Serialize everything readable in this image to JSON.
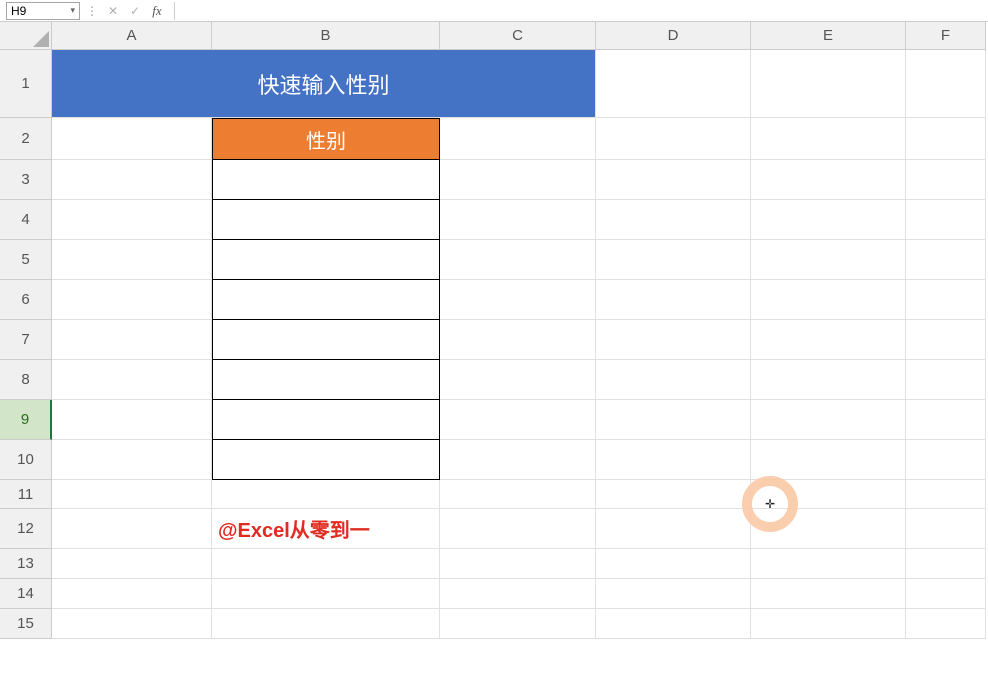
{
  "nameBox": {
    "value": "H9"
  },
  "formulaBar": {
    "cancel": "✕",
    "confirm": "✓",
    "fx": "fx",
    "value": ""
  },
  "columns": [
    "A",
    "B",
    "C",
    "D",
    "E",
    "F"
  ],
  "rows": [
    "1",
    "2",
    "3",
    "4",
    "5",
    "6",
    "7",
    "8",
    "9",
    "10",
    "11",
    "12",
    "13",
    "14",
    "15"
  ],
  "selectedRow": "9",
  "cells": {
    "title": "快速输入性别",
    "b2": "性别",
    "b12": "@Excel从零到一"
  },
  "chart_data": {
    "type": "table",
    "title": "快速输入性别",
    "columns": [
      "性别"
    ],
    "rows": [
      [
        ""
      ],
      [
        ""
      ],
      [
        ""
      ],
      [
        ""
      ],
      [
        ""
      ],
      [
        ""
      ],
      [
        ""
      ],
      [
        ""
      ]
    ],
    "note": "Column B rows 3–10 are empty bordered cells for gender input"
  }
}
